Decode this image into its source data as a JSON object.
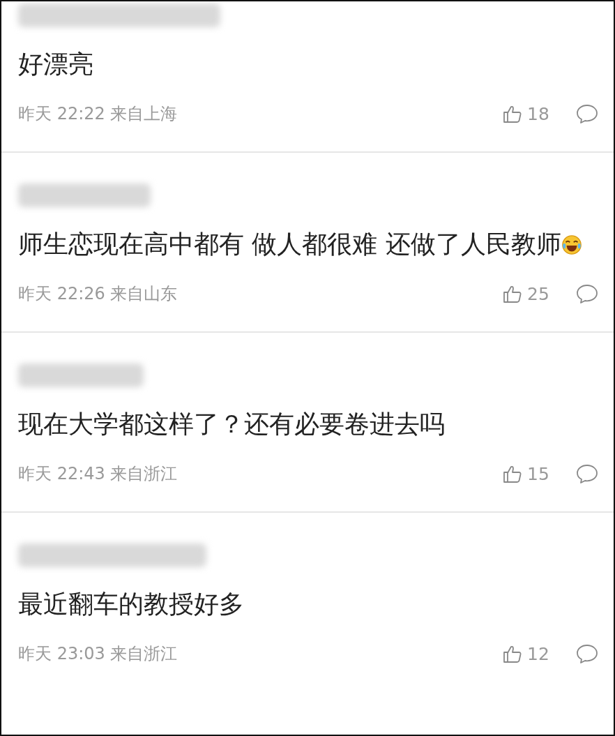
{
  "comments": [
    {
      "text": "好漂亮",
      "emoji": false,
      "meta": "昨天 22:22 来自上海",
      "likes": "18"
    },
    {
      "text": "师生恋现在高中都有 做人都很难 还做了人民教师",
      "emoji": true,
      "meta": "昨天 22:26 来自山东",
      "likes": "25"
    },
    {
      "text": "现在大学都这样了？还有必要卷进去吗",
      "emoji": false,
      "meta": "昨天 22:43 来自浙江",
      "likes": "15"
    },
    {
      "text": "最近翻车的教授好多",
      "emoji": false,
      "meta": "昨天 23:03 来自浙江",
      "likes": "12"
    }
  ]
}
